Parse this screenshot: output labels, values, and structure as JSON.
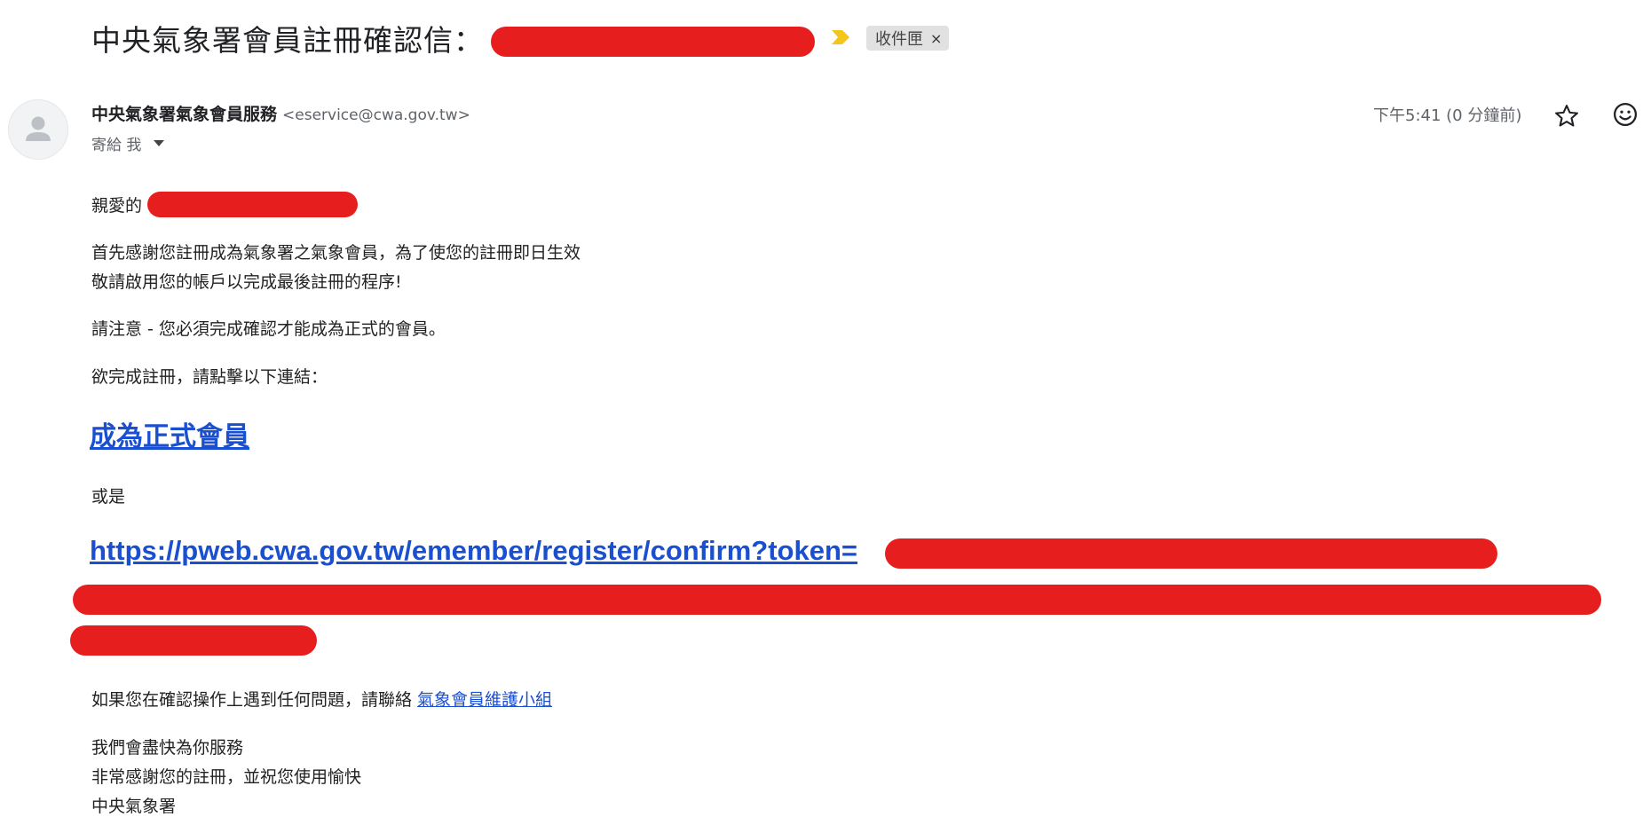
{
  "email": {
    "subject": "中央氣象署會員註冊確認信：",
    "label": "收件匣",
    "label_close": "×",
    "sender_name": "中央氣象署氣象會員服務",
    "sender_email": "<eservice@cwa.gov.tw>",
    "to_text": "寄給 我",
    "timestamp": "下午5:41 (0 分鐘前)"
  },
  "body": {
    "greeting": "親愛的",
    "para1_line1": "首先感謝您註冊成為氣象署之氣象會員，為了使您的註冊即日生效",
    "para1_line2": "敬請啟用您的帳戶以完成最後註冊的程序!",
    "notice": "請注意 - 您必須完成確認才能成為正式的會員。",
    "instruction": "欲完成註冊，請點擊以下連結：",
    "confirm_link": "成為正式會員",
    "or_text": "或是",
    "confirm_url": "https://pweb.cwa.gov.tw/emember/register/confirm?token=",
    "help_text": "如果您在確認操作上遇到任何問題，請聯絡 ",
    "help_link": "氣象會員維護小組",
    "closing1": "我們會盡快為你服務",
    "closing2": "非常感謝您的註冊，並祝您使用愉快",
    "signature": "中央氣象署"
  },
  "icons": {
    "important": "label-important-icon",
    "star": "star-icon",
    "emoji": "emoji-reaction-icon",
    "avatar": "person-icon",
    "dropdown": "chevron-down-icon"
  },
  "colors": {
    "link": "#1a4fd0",
    "redaction": "#e61e1e",
    "important_marker": "#f4c51c",
    "label_chip": "#e1e1e1"
  }
}
